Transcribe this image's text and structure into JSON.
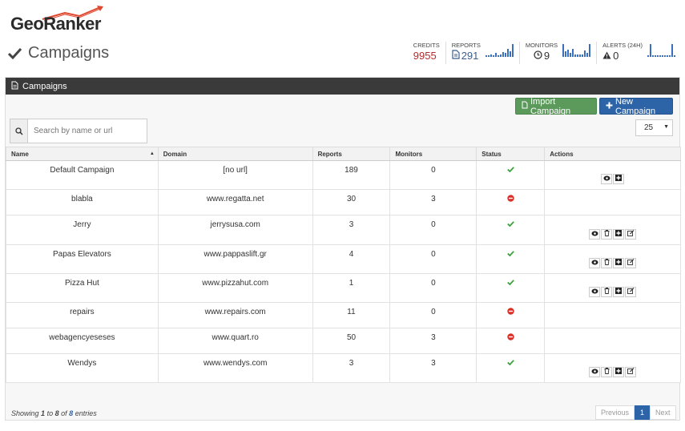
{
  "brand": {
    "logo_text": "GeoRanker"
  },
  "page": {
    "title": "Campaigns"
  },
  "stats": {
    "credits": {
      "label": "CREDITS",
      "value": "9955"
    },
    "reports": {
      "label": "REPORTS",
      "value": "291",
      "sparkline": [
        2,
        2,
        3,
        2,
        4,
        2,
        3,
        5,
        4,
        9,
        6,
        14
      ]
    },
    "monitors": {
      "label": "MONITORS",
      "value": "9",
      "sparkline": [
        14,
        6,
        8,
        4,
        9,
        3,
        3,
        3,
        3,
        7,
        4,
        14
      ]
    },
    "alerts": {
      "label": "ALERTS (24H)",
      "value": "0",
      "sparkline": [
        2,
        14,
        2,
        2,
        2,
        2,
        2,
        2,
        2,
        2,
        14,
        2
      ]
    }
  },
  "panel": {
    "title": "Campaigns"
  },
  "toolbar": {
    "import_label": "Import Campaign",
    "new_label": "New Campaign",
    "search_placeholder": "Search by name or url",
    "page_size": "25"
  },
  "table": {
    "columns": [
      "Name",
      "Domain",
      "Reports",
      "Monitors",
      "Status",
      "Actions"
    ],
    "rows": [
      {
        "name": "Default Campaign",
        "domain": "[no url]",
        "reports": "189",
        "monitors": "0",
        "status": "active",
        "actions": [
          "view",
          "add"
        ]
      },
      {
        "name": "blabla",
        "domain": "www.regatta.net",
        "reports": "30",
        "monitors": "3",
        "status": "inactive",
        "actions": []
      },
      {
        "name": "Jerry",
        "domain": "jerrysusa.com",
        "reports": "3",
        "monitors": "0",
        "status": "active",
        "actions": [
          "view",
          "delete",
          "add",
          "edit"
        ]
      },
      {
        "name": "Papas Elevators",
        "domain": "www.pappaslift.gr",
        "reports": "4",
        "monitors": "0",
        "status": "active",
        "actions": [
          "view",
          "delete",
          "add",
          "edit"
        ]
      },
      {
        "name": "Pizza Hut",
        "domain": "www.pizzahut.com",
        "reports": "1",
        "monitors": "0",
        "status": "active",
        "actions": [
          "view",
          "delete",
          "add",
          "edit"
        ]
      },
      {
        "name": "repairs",
        "domain": "www.repairs.com",
        "reports": "11",
        "monitors": "0",
        "status": "inactive",
        "actions": []
      },
      {
        "name": "webagencyeseses",
        "domain": "www.quart.ro",
        "reports": "50",
        "monitors": "3",
        "status": "inactive",
        "actions": []
      },
      {
        "name": "Wendys",
        "domain": "www.wendys.com",
        "reports": "3",
        "monitors": "3",
        "status": "active",
        "actions": [
          "view",
          "delete",
          "add",
          "edit"
        ]
      }
    ]
  },
  "footer": {
    "showing": "Showing",
    "from": "1",
    "to_word": "to",
    "to": "8",
    "of_word": "of",
    "total": "8",
    "entries_word": "entries"
  },
  "pager": {
    "previous": "Previous",
    "current": "1",
    "next": "Next"
  },
  "colors": {
    "accent": "#2d64a8",
    "success": "#3aa13a",
    "danger": "#d9312a",
    "credits": "#b52a2a",
    "header": "#3a3a3a"
  }
}
